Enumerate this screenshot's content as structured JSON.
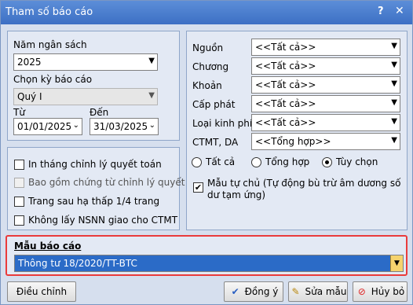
{
  "window": {
    "title": "Tham số báo cáo",
    "help_label": "?",
    "close_label": "✕"
  },
  "left": {
    "nam_ngan_sach_label": "Năm ngân sách",
    "nam_ngan_sach_value": "2025",
    "chon_ky_label": "Chọn kỳ báo cáo",
    "chon_ky_value": "Quý I",
    "tu_label": "Từ",
    "tu_value": "01/01/2025",
    "den_label": "Đến",
    "den_value": "31/03/2025",
    "options": [
      {
        "label": "In tháng chỉnh lý quyết toán",
        "checked": false,
        "enabled": true
      },
      {
        "label": "Bao gồm chứng từ chỉnh lý quyết toán",
        "checked": false,
        "enabled": false
      },
      {
        "label": "Trang sau hạ thấp 1/4 trang",
        "checked": false,
        "enabled": true
      },
      {
        "label": "Không lấy NSNN giao cho CTMT",
        "checked": false,
        "enabled": true
      }
    ]
  },
  "right": {
    "fields": [
      {
        "label": "Nguồn",
        "value": "<<Tất cả>>"
      },
      {
        "label": "Chương",
        "value": "<<Tất cả>>"
      },
      {
        "label": "Khoản",
        "value": "<<Tất cả>>"
      },
      {
        "label": "Cấp phát",
        "value": "<<Tất cả>>"
      },
      {
        "label": "Loại kinh phí",
        "value": "<<Tất cả>>"
      },
      {
        "label": "CTMT, DA",
        "value": "<<Tổng hợp>>"
      }
    ],
    "radios": [
      {
        "label": "Tất cả",
        "selected": false
      },
      {
        "label": "Tổng hợp",
        "selected": false
      },
      {
        "label": "Tùy chọn",
        "selected": true
      }
    ],
    "mau_tu_chu_label": "Mẫu tự chủ (Tự động bù trừ âm dương số dư tạm ứng)",
    "mau_tu_chu_checked": true
  },
  "mau_bao_cao": {
    "label": "Mẫu báo cáo",
    "value": "Thông tư 18/2020/TT-BTC"
  },
  "buttons": {
    "dieu_chinh": "Điều chỉnh",
    "dong_y": "Đồng ý",
    "sua_mau": "Sửa mẫu",
    "huy_bo": "Hủy bỏ"
  },
  "colors": {
    "titlebar": "#4a7fd0",
    "highlight_border": "#ea3b3b",
    "selected_value_bg": "#2b6bc7"
  }
}
